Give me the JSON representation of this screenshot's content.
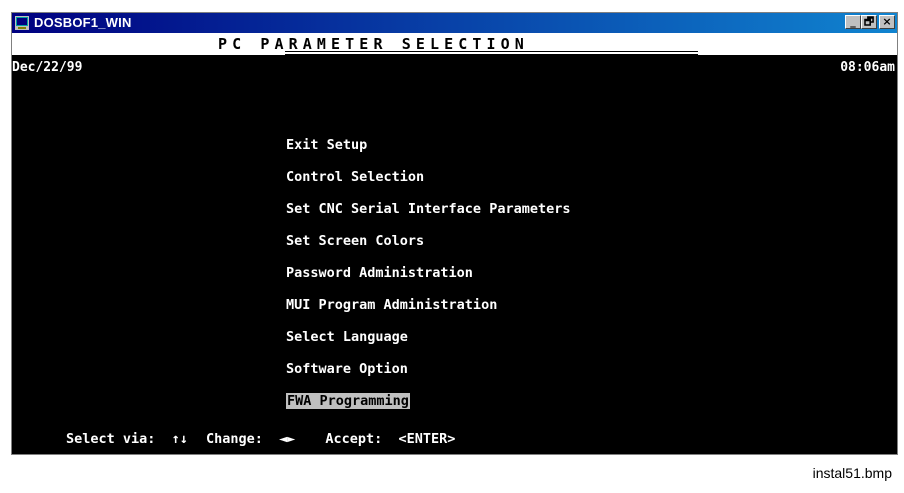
{
  "window": {
    "title": "DOSBOF1_WIN",
    "controls": {
      "minimize": "_",
      "restore": "🗗",
      "close": "×"
    }
  },
  "header": {
    "title": "PC PARAMETER SELECTION"
  },
  "date": "Dec/22/99",
  "time": "08:06am",
  "menu": {
    "items": [
      "Exit Setup",
      "Control Selection",
      "Set CNC Serial Interface Parameters",
      "Set Screen Colors",
      "Password Administration",
      "MUI Program Administration",
      "Select Language",
      "Software Option",
      "FWA Programming"
    ],
    "selected_index": 8
  },
  "status": {
    "select_label": "Select via:",
    "select_keys": "↑↓",
    "change_label": "Change:",
    "change_keys": "◄►",
    "accept_label": "Accept:",
    "accept_key": "<ENTER>"
  },
  "caption": "instal51.bmp",
  "colors": {
    "titlebar_start": "#000080",
    "titlebar_end": "#1084d0",
    "screen_bg": "#000000",
    "text": "#ffffff",
    "highlight_bg": "#c0c0c0"
  },
  "icons": {
    "app": "dos-window-icon"
  }
}
